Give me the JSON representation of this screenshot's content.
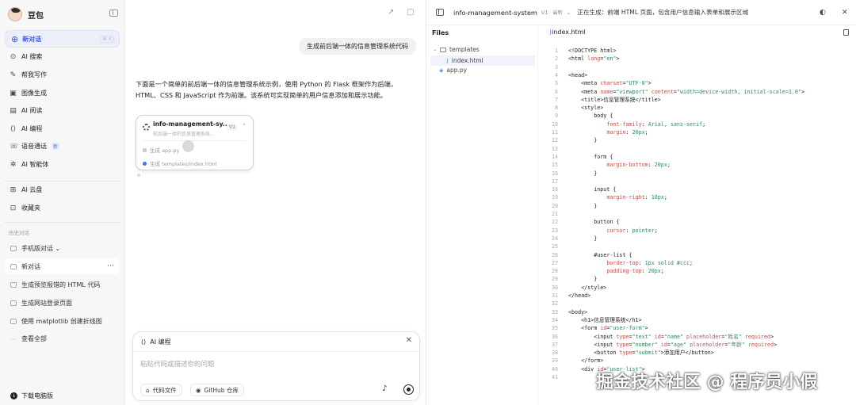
{
  "sidebar": {
    "brand": "豆包",
    "new_chat": "新对话",
    "new_chat_kbd": "⌘ K",
    "nav": [
      {
        "label": "AI 搜索",
        "icon": "search-icon",
        "glyph": "⊙"
      },
      {
        "label": "帮我写作",
        "icon": "pen-icon",
        "glyph": "✎"
      },
      {
        "label": "图像生成",
        "icon": "image-icon",
        "glyph": "▣"
      },
      {
        "label": "AI 阅读",
        "icon": "book-icon",
        "glyph": "▤"
      },
      {
        "label": "AI 编程",
        "icon": "code-icon",
        "glyph": "⟨⟩"
      },
      {
        "label": "语音通话",
        "icon": "phone-icon",
        "glyph": "☏",
        "badge": "新"
      },
      {
        "label": "AI 智能体",
        "icon": "agent-icon",
        "glyph": "✲"
      }
    ],
    "nav2": [
      {
        "label": "AI 云盘",
        "icon": "cloud-icon",
        "glyph": "⊞"
      },
      {
        "label": "收藏夹",
        "icon": "bookmark-icon",
        "glyph": "⊡"
      }
    ],
    "history_header": "历史对话",
    "history": [
      {
        "label": "手机版对话 ⌄"
      },
      {
        "label": "新对话",
        "active": true
      },
      {
        "label": "生成预览报错的 HTML 代码"
      },
      {
        "label": "生成网站登录页面"
      },
      {
        "label": "使用 matplotlib 创建折线图"
      },
      {
        "label": "查看全部"
      }
    ],
    "download": "下载电脑版"
  },
  "chat": {
    "user_message": "生成前后端一体的信息管理系统代码",
    "answer": "下面是一个简单的前后端一体的信息管理系统示例，使用 Python 的 Flask 框架作为后端，HTML、CSS 和 JavaScript 作为前端。该系统可实现简单的用户信息添加和展示功能。",
    "card": {
      "title": "info-management-sy...",
      "subtitle": "前后端一体的信息管理系统...",
      "version": "V1",
      "steps": [
        "生成 app.py",
        "生成 templates/index.html"
      ]
    },
    "composer": {
      "mode": "AI 编程",
      "placeholder": "粘贴代码或描述你的问题",
      "chip_files": "代码文件",
      "chip_github": "GitHub 仓库"
    }
  },
  "code_panel": {
    "project": "info-management-system",
    "version": "V1",
    "latest": "最新",
    "status": "正在生成：前端 HTML 页面，包含用户信息输入表单和展示区域",
    "files_header": "Files",
    "tree": [
      {
        "label": "templates",
        "type": "folder"
      },
      {
        "label": "index.html",
        "type": "file",
        "selected": true
      },
      {
        "label": "app.py",
        "type": "file"
      }
    ],
    "tab": "index.html"
  },
  "watermark": "掘金技术社区 @ 程序员小假"
}
